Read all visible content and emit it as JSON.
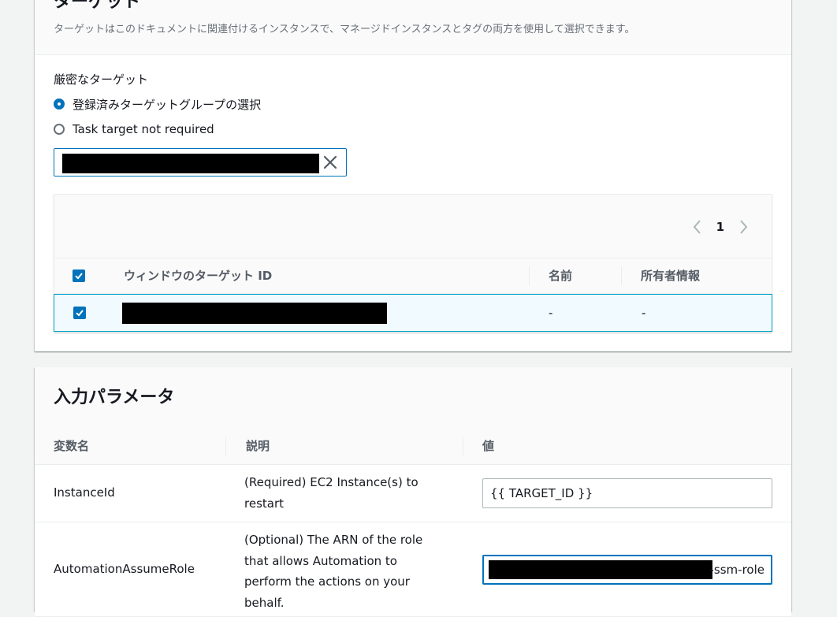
{
  "target_section": {
    "title": "ターゲット",
    "description": "ターゲットはこのドキュメントに関連付けるインスタンスで、マネージドインスタンスとタグの両方を使用して選択できます。",
    "field_label": "厳密なターゲット",
    "options": [
      {
        "label": "登録済みターゲットグループの選択",
        "selected": true
      },
      {
        "label": "Task target not required",
        "selected": false
      }
    ],
    "pagination": {
      "current_page": "1"
    },
    "columns": [
      "ウィンドウのターゲット ID",
      "名前",
      "所有者情報"
    ],
    "rows": [
      {
        "checked": true,
        "name": "-",
        "owner": "-"
      }
    ]
  },
  "params_section": {
    "title": "入力パラメータ",
    "columns": [
      "変数名",
      "説明",
      "値"
    ],
    "rows": [
      {
        "name": "InstanceId",
        "description": "(Required) EC2 Instance(s) to restart",
        "value": "{{ TARGET_ID }}"
      },
      {
        "name": "AutomationAssumeRole",
        "description": "(Optional) The ARN of the role that allows Automation to perform the actions on your behalf.",
        "value_suffix": "-ssm-role"
      }
    ]
  },
  "colors": {
    "accent": "#0073bb",
    "selected_row_bg": "#f1faff",
    "selected_row_border": "#00a1c9"
  }
}
